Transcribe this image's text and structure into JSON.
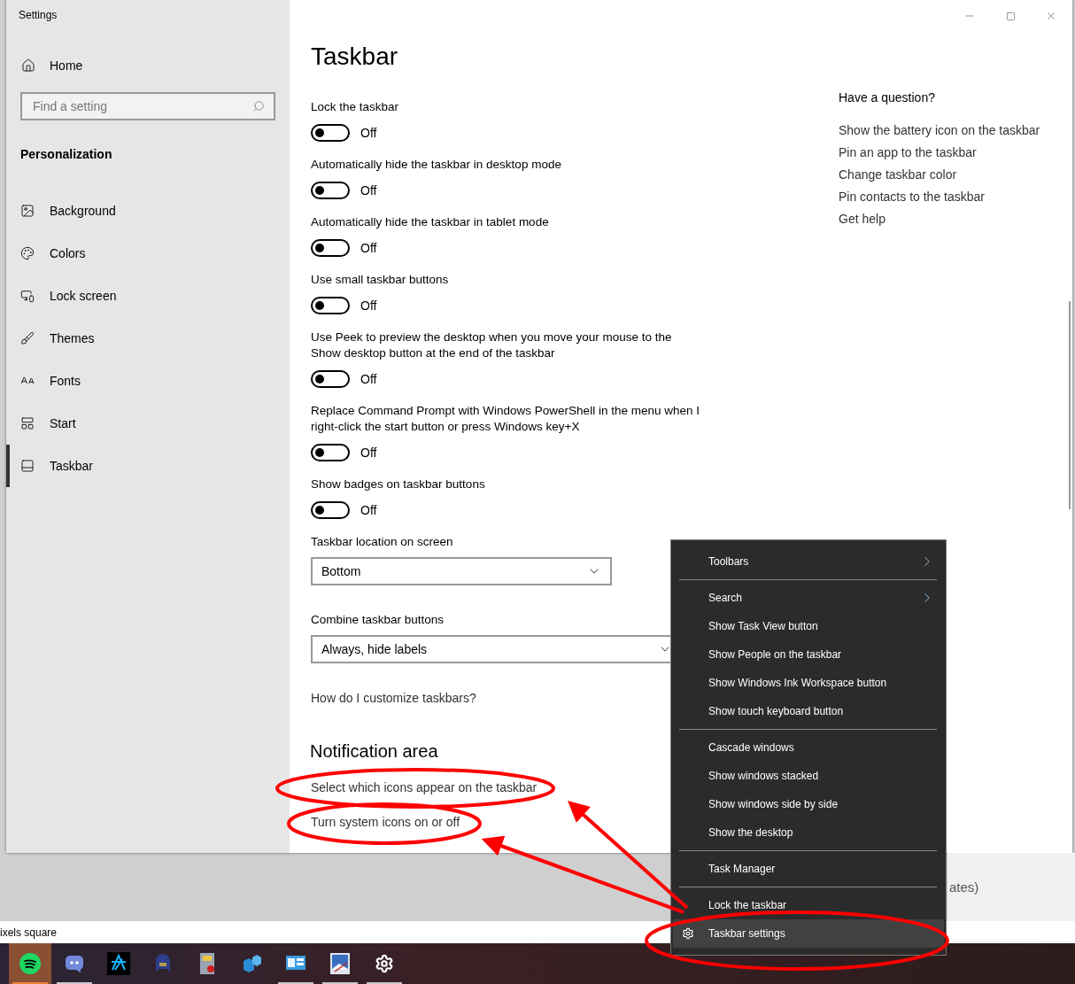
{
  "window": {
    "title": "Settings"
  },
  "sidebar": {
    "home": "Home",
    "search": {
      "placeholder": "Find a setting"
    },
    "section": "Personalization",
    "items": [
      {
        "label": "Background",
        "kind": "background",
        "selected": false
      },
      {
        "label": "Colors",
        "kind": "colors",
        "selected": false
      },
      {
        "label": "Lock screen",
        "kind": "lockscreen",
        "selected": false
      },
      {
        "label": "Themes",
        "kind": "themes",
        "selected": false
      },
      {
        "label": "Fonts",
        "kind": "fonts",
        "selected": false
      },
      {
        "label": "Start",
        "kind": "start",
        "selected": false
      },
      {
        "label": "Taskbar",
        "kind": "taskbar",
        "selected": true
      }
    ]
  },
  "page": {
    "title": "Taskbar",
    "settings": [
      {
        "label": "Lock the taskbar",
        "on": false,
        "state": "Off"
      },
      {
        "label": "Automatically hide the taskbar in desktop mode",
        "on": false,
        "state": "Off"
      },
      {
        "label": "Automatically hide the taskbar in tablet mode",
        "on": false,
        "state": "Off"
      },
      {
        "label": "Use small taskbar buttons",
        "on": false,
        "state": "Off"
      },
      {
        "label": "Use Peek to preview the desktop when you move your mouse to the Show desktop button at the end of the taskbar",
        "on": false,
        "state": "Off"
      },
      {
        "label": "Replace Command Prompt with Windows PowerShell in the menu when I right-click the start button or press Windows key+X",
        "on": false,
        "state": "Off"
      },
      {
        "label": "Show badges on taskbar buttons",
        "on": false,
        "state": "Off"
      }
    ],
    "dropdowns": [
      {
        "label": "Taskbar location on screen",
        "value": "Bottom"
      },
      {
        "label": "Combine taskbar buttons",
        "value": "Always, hide labels"
      }
    ],
    "help_link": "How do I customize taskbars?",
    "notification_area": {
      "title": "Notification area",
      "links": [
        "Select which icons appear on the taskbar",
        "Turn system icons on or off"
      ]
    }
  },
  "related": {
    "title": "Have a question?",
    "links": [
      "Show the battery icon on the taskbar",
      "Pin an app to the taskbar",
      "Change taskbar color",
      "Pin contacts to the taskbar",
      "Get help"
    ]
  },
  "background_text": "ates)",
  "status_strip": "ixels square",
  "taskbar": {
    "items": [
      {
        "kind": "spotify",
        "selected": true,
        "running": true
      },
      {
        "kind": "discord",
        "selected": false,
        "running": true
      },
      {
        "kind": "battlenet",
        "selected": false,
        "running": false
      },
      {
        "kind": "game",
        "selected": false,
        "running": false
      },
      {
        "kind": "notebook",
        "selected": false,
        "running": false
      },
      {
        "kind": "cubes",
        "selected": false,
        "running": false
      },
      {
        "kind": "panel",
        "selected": false,
        "running": true
      },
      {
        "kind": "picture",
        "selected": false,
        "running": true
      },
      {
        "kind": "gear",
        "selected": false,
        "running": true
      }
    ]
  },
  "context_menu": {
    "items": [
      {
        "kind": "item",
        "label": "Toolbars",
        "submenu": true,
        "selected": false
      },
      {
        "kind": "separator"
      },
      {
        "kind": "item",
        "label": "Search",
        "submenu": true,
        "selected": false
      },
      {
        "kind": "item",
        "label": "Show Task View button",
        "submenu": false,
        "selected": false
      },
      {
        "kind": "item",
        "label": "Show People on the taskbar",
        "submenu": false,
        "selected": false
      },
      {
        "kind": "item",
        "label": "Show Windows Ink Workspace button",
        "submenu": false,
        "selected": false
      },
      {
        "kind": "item",
        "label": "Show touch keyboard button",
        "submenu": false,
        "selected": false
      },
      {
        "kind": "separator"
      },
      {
        "kind": "item",
        "label": "Cascade windows",
        "submenu": false,
        "selected": false
      },
      {
        "kind": "item",
        "label": "Show windows stacked",
        "submenu": false,
        "selected": false
      },
      {
        "kind": "item",
        "label": "Show windows side by side",
        "submenu": false,
        "selected": false
      },
      {
        "kind": "item",
        "label": "Show the desktop",
        "submenu": false,
        "selected": false
      },
      {
        "kind": "separator"
      },
      {
        "kind": "item",
        "label": "Task Manager",
        "submenu": false,
        "selected": false
      },
      {
        "kind": "separator"
      },
      {
        "kind": "item",
        "label": "Lock the taskbar",
        "submenu": false,
        "selected": false
      },
      {
        "kind": "settings",
        "label": "Taskbar settings",
        "submenu": false,
        "selected": true
      }
    ]
  }
}
